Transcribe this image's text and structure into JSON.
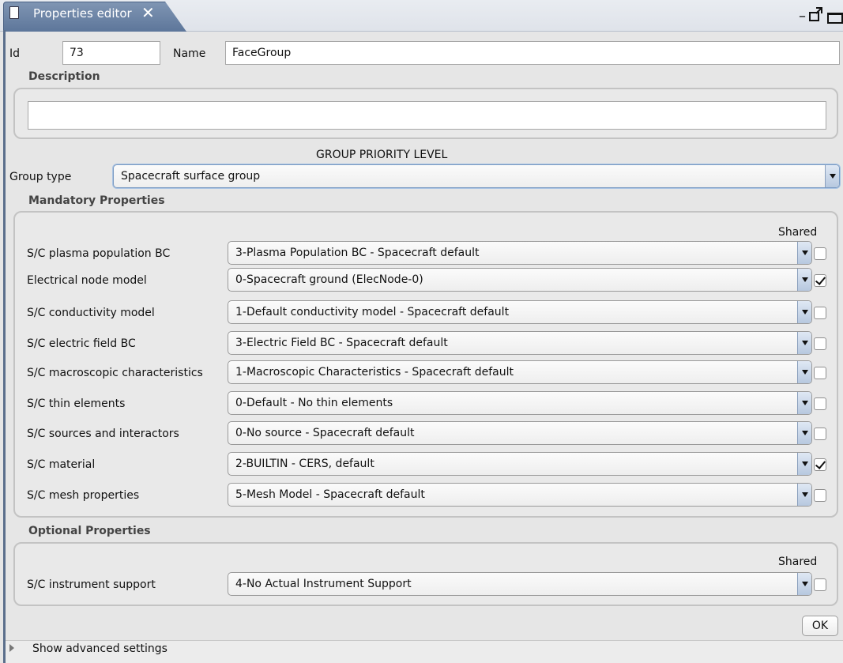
{
  "window": {
    "tab_title": "Properties editor",
    "close_glyph": "✕",
    "minimize_glyph": "–"
  },
  "header": {
    "id_label": "Id",
    "id_value": "73",
    "name_label": "Name",
    "name_value": "FaceGroup"
  },
  "description": {
    "title": "Description",
    "value": ""
  },
  "group": {
    "priority_heading": "GROUP PRIORITY LEVEL",
    "type_label": "Group type",
    "type_value": "Spacecraft surface group"
  },
  "mandatory": {
    "title": "Mandatory Properties",
    "shared_header": "Shared",
    "rows": [
      {
        "label": "S/C plasma population BC",
        "value": "3-Plasma Population BC - Spacecraft default",
        "shared": false
      },
      {
        "label": "Electrical node model",
        "value": "0-Spacecraft ground (ElecNode-0)",
        "shared": true
      },
      {
        "label": "S/C conductivity model",
        "value": "1-Default conductivity model - Spacecraft default",
        "shared": false
      },
      {
        "label": "S/C electric field BC",
        "value": "3-Electric Field BC - Spacecraft default",
        "shared": false
      },
      {
        "label": "S/C macroscopic characteristics",
        "value": "1-Macroscopic Characteristics - Spacecraft default",
        "shared": false
      },
      {
        "label": "S/C thin elements",
        "value": "0-Default - No thin elements",
        "shared": false
      },
      {
        "label": "S/C sources and interactors",
        "value": "0-No source - Spacecraft default",
        "shared": false
      },
      {
        "label": "S/C material",
        "value": "2-BUILTIN - CERS, default",
        "shared": true
      },
      {
        "label": "S/C mesh properties",
        "value": "5-Mesh Model - Spacecraft default",
        "shared": false
      }
    ]
  },
  "optional": {
    "title": "Optional Properties",
    "shared_header": "Shared",
    "rows": [
      {
        "label": "S/C instrument support",
        "value": "4-No Actual Instrument Support",
        "shared": false
      }
    ]
  },
  "footer": {
    "ok_label": "OK",
    "advanced_label": "Show advanced settings"
  },
  "colors": {
    "tab_active": "#6d84a7",
    "combo_arrow": "#b7c8df",
    "background": "#ececec"
  }
}
